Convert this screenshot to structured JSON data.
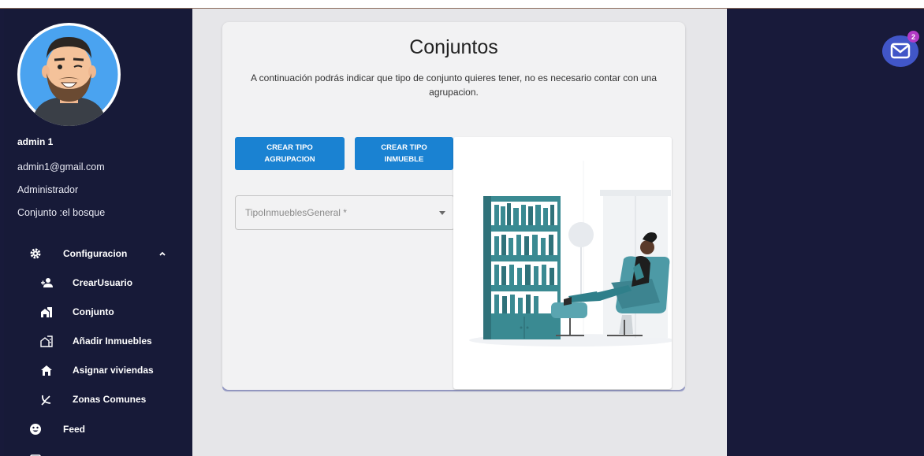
{
  "user": {
    "name": "admin 1",
    "email": "admin1@gmail.com",
    "role": "Administrador",
    "conjunto": "Conjunto :el bosque"
  },
  "nav": {
    "items": [
      {
        "label": "Configuracion",
        "icon": "gear-icon"
      },
      {
        "label": "CrearUsuario",
        "icon": "add-user-icon"
      },
      {
        "label": "Conjunto",
        "icon": "buildings-icon"
      },
      {
        "label": "Añadir Inmuebles",
        "icon": "add-home-icon"
      },
      {
        "label": "Asignar viviendas",
        "icon": "home-icon"
      },
      {
        "label": "Zonas Comunes",
        "icon": "satellite-dish-icon"
      },
      {
        "label": "Feed",
        "icon": "smiley-icon"
      }
    ]
  },
  "page": {
    "title": "Conjuntos",
    "description": "A continuación podrás indicar que tipo de conjunto quieres tener, no es necesario contar con una agrupacion.",
    "btn_agrupacion": "CREAR TIPO AGRUPACION",
    "btn_inmueble": "CREAR TIPO INMUEBLE",
    "select_placeholder": "TipoInmueblesGeneral *"
  },
  "mail": {
    "badge_count": "2"
  },
  "colors": {
    "sidebar": "#171a38",
    "button": "#1a82d2",
    "badge": "#b33ac5",
    "mail": "#4156c8"
  }
}
